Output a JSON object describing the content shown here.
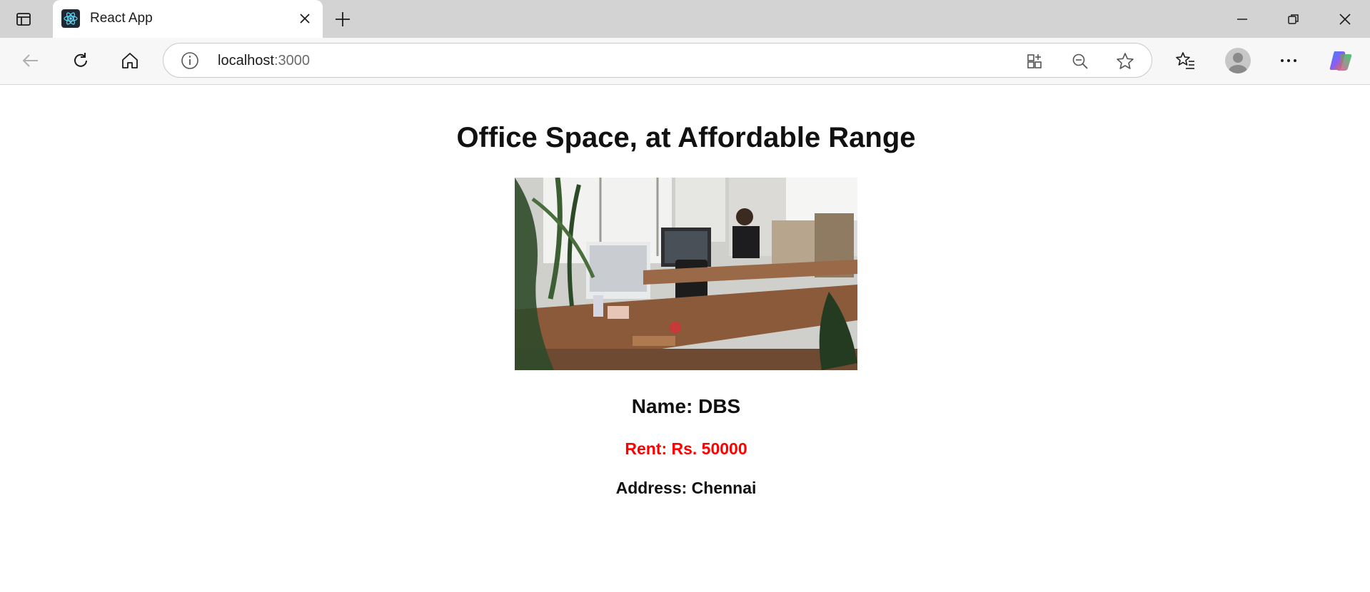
{
  "browser": {
    "tab": {
      "title": "React App",
      "favicon": "react-logo-icon"
    },
    "address": {
      "host": "localhost",
      "port": ":3000"
    },
    "colors": {
      "tabstrip": "#d3d3d3",
      "toolbar": "#f7f7f7"
    }
  },
  "page": {
    "title": "Office Space, at Affordable Range",
    "image": {
      "alt": "Office space",
      "description_icon": "office-photo"
    },
    "office": {
      "name_label": "Name: DBS",
      "rent_label": "Rent: Rs. 50000",
      "address_label": "Address: Chennai"
    },
    "colors": {
      "rent_text": "#ff0000"
    }
  }
}
